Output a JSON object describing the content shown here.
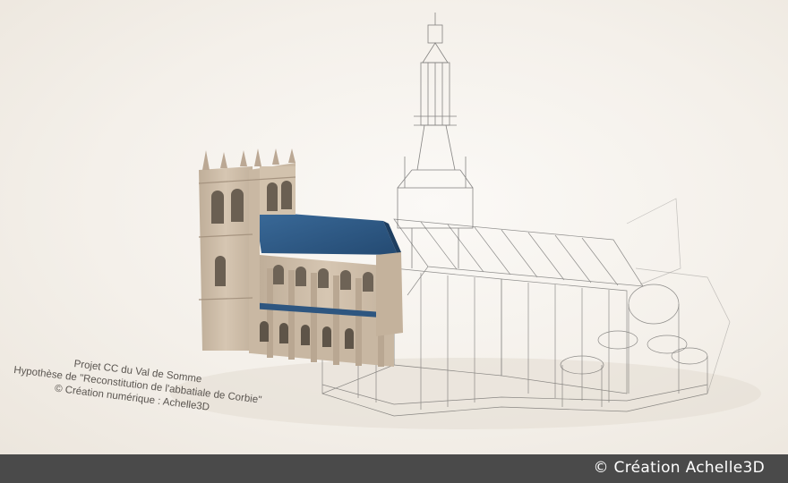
{
  "image": {
    "subject": "3d-reconstruction-abbey-church",
    "caption_lines": [
      "Projet CC du Val de Somme",
      "Hypothèse de \"Reconstitution de l'abbatiale de Corbie\"",
      "©  Création numérique : Achelle3D"
    ]
  },
  "footer": {
    "credit": "© Création Achelle3D"
  },
  "colors": {
    "background": "#f3efe9",
    "stone": "#cdbba6",
    "roof": "#2e5a87",
    "wireframe": "#3a3a3a",
    "footer_bar": "#4a4a4a"
  }
}
